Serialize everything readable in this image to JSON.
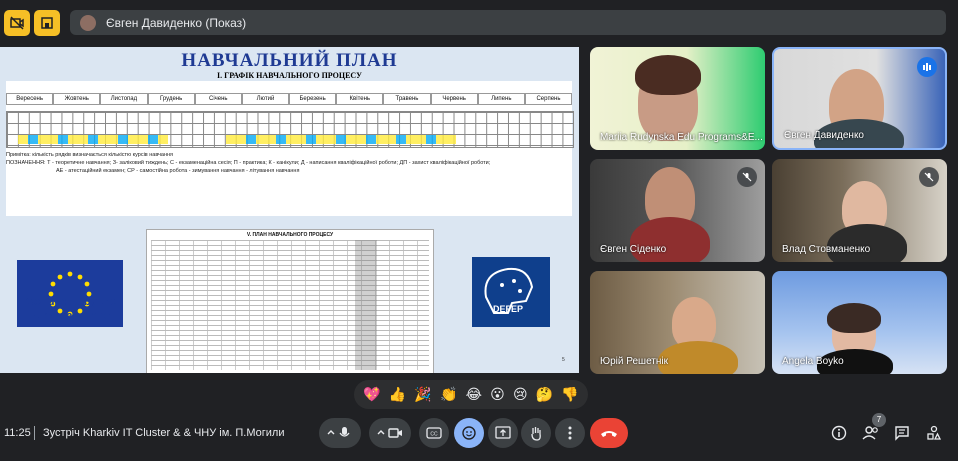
{
  "presenter": {
    "label": "Євген Давиденко (Показ)"
  },
  "slide": {
    "title": "НАВЧАЛЬНИЙ ПЛАН",
    "subtitle": "І. ГРАФІК НАВЧАЛЬНОГО ПРОЦЕСУ",
    "months": [
      "Вересень",
      "Жовтень",
      "Листопад",
      "Грудень",
      "Січень",
      "Лютий",
      "Березень",
      "Квітень",
      "Травень",
      "Червень",
      "Липень",
      "Серпень"
    ],
    "note_line1": "Примітка: кількість рядків визначається кількістю курсів навчання",
    "note_line2": "ПОЗНАЧЕННЯ: Т - теоретичне навчання; З- заліковий тиждень; С - екзаменаційна сесія; П - практика; К - канікули; Д - написання кваліфікаційної роботи; ДП - захист кваліфікаційної роботи;",
    "note_line3": "АЕ - атестаційний екзамен; СР - самостійна робота   - зимування навчання   - літування навчання",
    "doc_title": "V. ПЛАН НАВЧАЛЬНОГО ПРОЦЕСУ",
    "eu_text": "Co-funded by the European Union",
    "defep_text": "DEFEP",
    "page_number": "5"
  },
  "participants": [
    {
      "name": "Mariia Rudynska Edu Programs&E...",
      "muted": false
    },
    {
      "name": "Євген Давиденко",
      "muted": false,
      "speaking": true
    },
    {
      "name": "Євген Сіденко",
      "muted": true
    },
    {
      "name": "Влад Стовманенко",
      "muted": true
    },
    {
      "name": "Юрій Решетнік",
      "muted": false
    },
    {
      "name": "Angela Boyko",
      "muted": false
    }
  ],
  "reactions": [
    "💖",
    "👍",
    "🎉",
    "👏",
    "😂",
    "😮",
    "😢",
    "🤔",
    "👎"
  ],
  "bottom": {
    "time": "11:25",
    "meeting_title": "Зустріч Kharkiv IT Cluster & & ЧНУ ім. П.Могили",
    "participant_count": "7"
  },
  "colors": {
    "accent": "#f6bf26",
    "hangup": "#ea4335",
    "active_reaction": "#8ab4f8"
  }
}
